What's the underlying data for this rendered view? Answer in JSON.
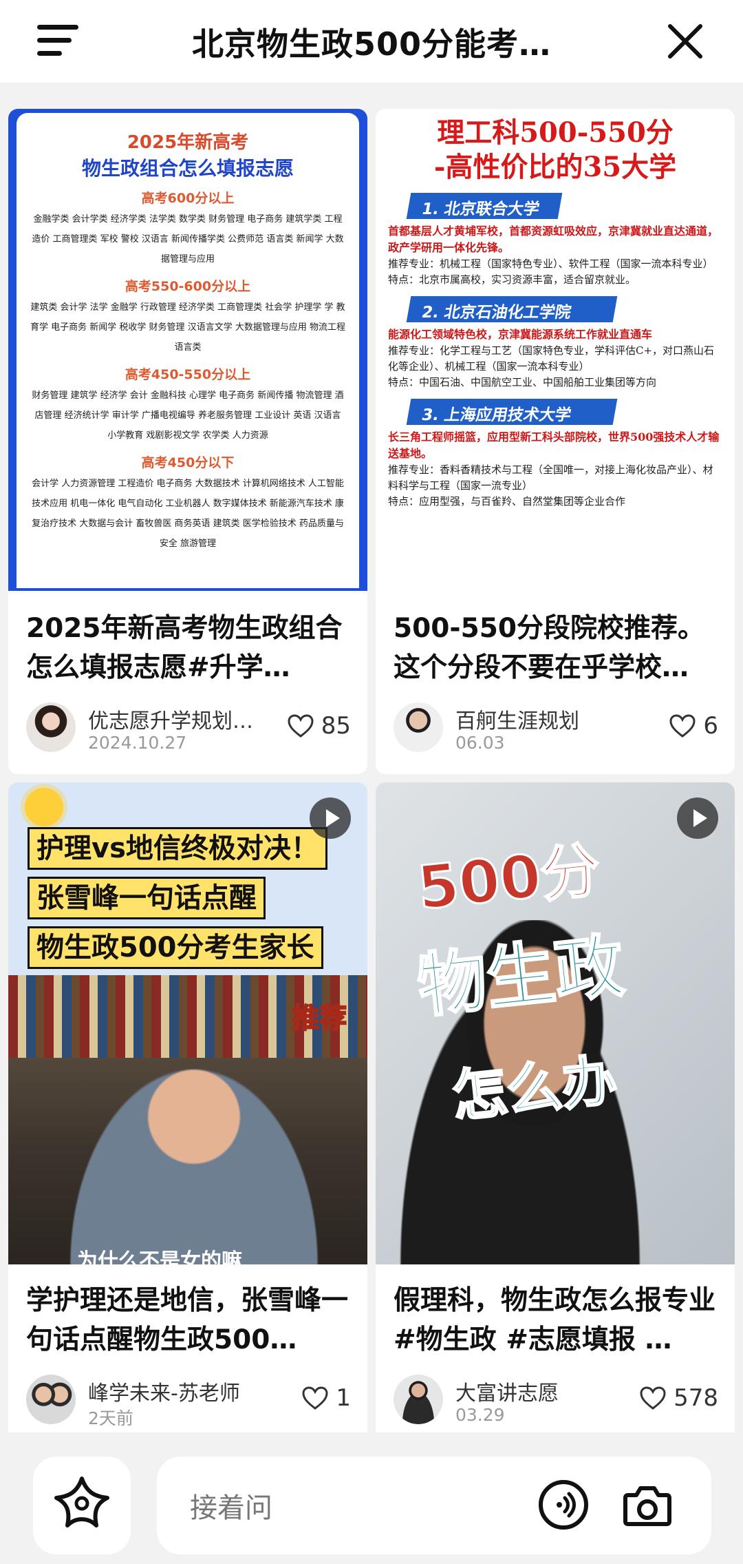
{
  "header": {
    "title": "北京物生政500分能考…",
    "menu_icon": "hamburger-menu-icon",
    "close_icon": "close-icon"
  },
  "cards": [
    {
      "poster": {
        "line1": "2025年新高考",
        "line2": "物生政组合怎么填报志愿",
        "sections": [
          {
            "head": "高考600分以上",
            "majors": "金融学类 会计学类 经济学类 法学类 数学类 财务管理 电子商务 建筑学类 工程造价 工商管理类 军校 警校 汉语言 新闻传播学类 公费师范 语言类 新闻学 大数据管理与应用"
          },
          {
            "head": "高考550-600分以上",
            "majors": "建筑类 会计学 法学 金融学 行政管理 经济学类 工商管理类 社会学 护理学 学 教育学 电子商务 新闻学 税收学 财务管理 汉语言文学 大数据管理与应用 物流工程 语言类"
          },
          {
            "head": "高考450-550分以上",
            "majors": "财务管理 建筑学 经济学 会计 金融科技 心理学 电子商务 新闻传播 物流管理 酒店管理 经济统计学 审计学 广播电视编导 养老服务管理 工业设计 英语 汉语言 小学教育 戏剧影视文学 农学类 人力资源"
          },
          {
            "head": "高考450分以下",
            "majors": "会计学 人力资源管理 工程造价 电子商务 大数据技术 计算机网络技术 人工智能技术应用 机电一体化 电气自动化 工业机器人 数字媒体技术 新能源汽车技术 康复治疗技术 大数据与会计 畜牧兽医 商务英语 建筑类 医学检验技术 药品质量与安全 旅游管理"
          }
        ]
      },
      "title": "2025年新高考物生政组合怎么填报志愿#升学…",
      "author": "优志愿升学规划…",
      "date": "2024.10.27",
      "likes": "85"
    },
    {
      "poster": {
        "headline1": "理工科500-550分",
        "headline2": "-高性价比的35大学",
        "unis": [
          {
            "name": "1. 北京联合大学",
            "red": "首都基层人才黄埔军校，首都资源虹吸效应，京津冀就业直达通道，政产学研用一体化先锋。",
            "major": "推荐专业：机械工程（国家特色专业）、软件工程（国家一流本科专业）",
            "feature": "特点：北京市属高校，实习资源丰富，适合留京就业。"
          },
          {
            "name": "2. 北京石油化工学院",
            "red": "能源化工领域特色校，京津冀能源系统工作就业直通车",
            "major": "推荐专业：化学工程与工艺（国家特色专业，学科评估C+，对口燕山石化等企业）、机械工程（国家一流本科专业）",
            "feature": "特点：中国石油、中国航空工业、中国船舶工业集团等方向"
          },
          {
            "name": "3. 上海应用技术大学",
            "red": "长三角工程师摇篮，应用型新工科头部院校，世界500强技术人才输送基地。",
            "major": "推荐专业：香料香精技术与工程（全国唯一，对接上海化妆品产业）、材料科学与工程（国家一流专业）",
            "feature": "特点：应用型强，与百雀羚、自然堂集团等企业合作"
          }
        ]
      },
      "title": "500-550分段院校推荐。这个分段不要在乎学校…",
      "author": "百舸生涯规划",
      "date": "06.03",
      "likes": "6"
    },
    {
      "poster": {
        "lines": [
          "护理vs地信终极对决！",
          "张雪峰一句话点醒",
          "物生政500分考生家长"
        ],
        "tag": "推荐",
        "subtitle": "为什么不是女的嘛"
      },
      "title": "学护理还是地信，张雪峰一句话点醒物生政500…",
      "author": "峰学未来-苏老师",
      "date": "2天前",
      "likes": "1"
    },
    {
      "poster": {
        "line1": "500分",
        "line2": "物生政",
        "line3": "怎么办"
      },
      "title": "假理科，物生政怎么报专业#物生政 #志愿填报 …",
      "author": "大富讲志愿",
      "date": "03.29",
      "likes": "578"
    }
  ],
  "bottom": {
    "placeholder": "接着问",
    "sparkle_icon": "sparkle-icon",
    "voice_icon": "voice-icon",
    "camera_icon": "camera-icon"
  },
  "colors": {
    "background": "#f2f2f2",
    "card": "#ffffff",
    "poster_blue": "#1d4fd8",
    "poster_red": "#d71919"
  }
}
